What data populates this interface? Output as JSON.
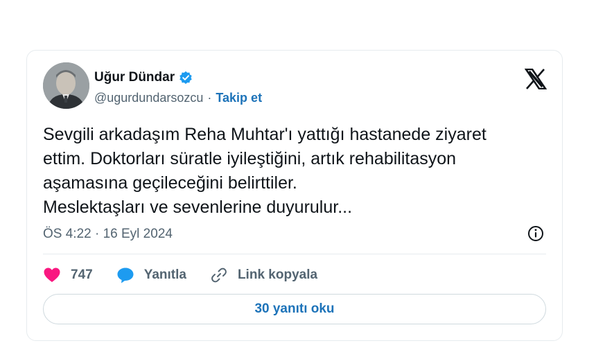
{
  "author": {
    "name": "Uğur Dündar",
    "handle": "@ugurdundarsozcu",
    "separator": "·",
    "follow_label": "Takip et",
    "verified": true,
    "verified_color": "#1d9bf0"
  },
  "tweet": {
    "text": "Sevgili arkadaşım Reha Muhtar'ı yattığı hastanede ziyaret\nettim. Doktorları süratle iyileştiğini, artık rehabilitasyon\naşamasına geçileceğini belirttiler.\nMeslektaşları ve sevenlerine duyurulur...",
    "timestamp": "ÖS 4:22 · 16 Eyl 2024"
  },
  "actions": {
    "likes_count": "747",
    "reply_label": "Yanıtla",
    "copy_link_label": "Link kopyala"
  },
  "read_replies_label": "30 yanıtı oku",
  "icons": {
    "platform": "x-logo-icon",
    "info": "info-icon",
    "like": "heart-icon",
    "reply": "speech-bubble-icon",
    "link": "link-icon"
  },
  "colors": {
    "like": "#f91880",
    "reply": "#1d9bf0",
    "link_text": "#1d73b9"
  }
}
